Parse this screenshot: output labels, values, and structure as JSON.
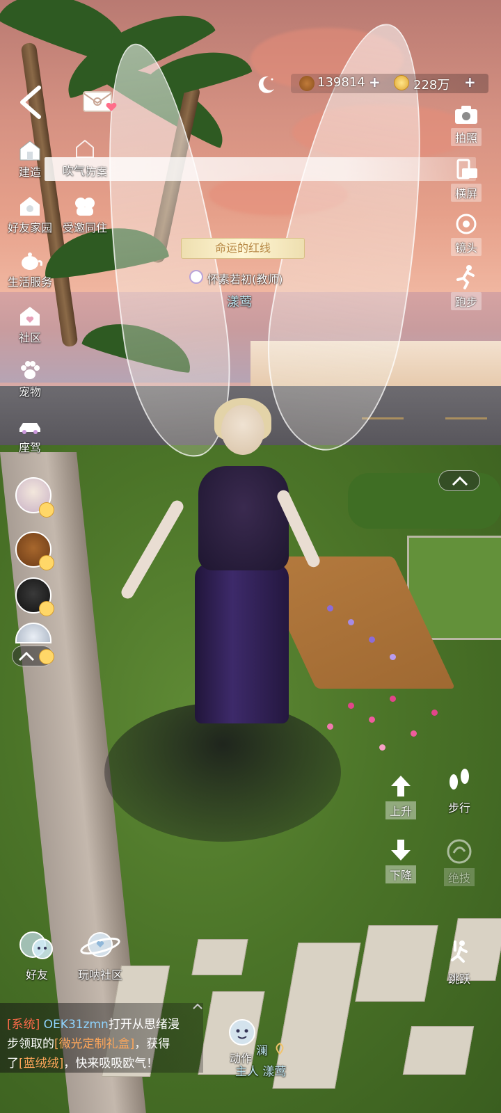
{
  "hud": {
    "currency": {
      "acorns": "139814",
      "coins": "228万",
      "plus": "+"
    },
    "message_bar_text": "吹气！",
    "message_bar_overlay": "方案",
    "left_menu": [
      {
        "label": "建造",
        "icon": "house-build-icon"
      },
      {
        "label": "好友家园",
        "icon": "friend-home-icon"
      },
      {
        "label": "受邀同住",
        "icon": "cohabit-icon"
      },
      {
        "label": "生活服务",
        "icon": "teapot-service-icon"
      },
      {
        "label": "社区",
        "icon": "community-icon"
      },
      {
        "label": "宠物",
        "icon": "paw-icon"
      },
      {
        "label": "座驾",
        "icon": "car-icon"
      }
    ],
    "right_menu": [
      {
        "label": "拍照",
        "icon": "camera-icon"
      },
      {
        "label": "横屏",
        "icon": "rotate-screen-icon"
      },
      {
        "label": "镜头",
        "icon": "lens-icon"
      },
      {
        "label": "跑步",
        "icon": "run-icon"
      }
    ],
    "character": {
      "title": "命运的红线",
      "guild": "怀素若初(教师)",
      "name": "漾莺"
    },
    "vertical_controls": {
      "up": "上升",
      "down": "下降",
      "walk": "步行",
      "skill": "绝技",
      "jump": "跳跃"
    },
    "bottom": {
      "friends": "好友",
      "community": "玩呐社区",
      "action": "动作",
      "owner_label": "主人 漾莺",
      "owner_short": "澜"
    },
    "expand_arrow": "^",
    "chat": {
      "tag": "[系统]",
      "user": "OEK31zmn",
      "line1_rest": "打开从思绪漫",
      "line2_a": "步领取的",
      "item1": "[微光定制礼盒]",
      "line2_b": "，获得",
      "line3_a": "了",
      "item2": "[蓝绒绒]",
      "line3_b": "，快来吸吸欧气！"
    }
  },
  "colors": {
    "system_tag": "#ff6b4a",
    "username": "#8fd4ff",
    "item": "#ffa75a",
    "nameplate_text": "#b88a48",
    "guild_name": "#ffffff",
    "player_name": "#bfe6f0"
  }
}
